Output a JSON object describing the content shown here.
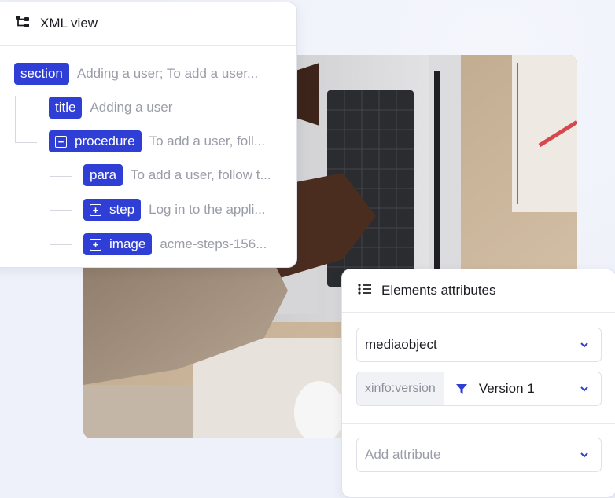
{
  "colors": {
    "accent": "#2f3fd6",
    "muted_text": "#9a9da8",
    "card_border": "#dfe2ea",
    "background": "#eef1f9"
  },
  "xml_view": {
    "title": "XML view",
    "icon": "tree-structure-icon",
    "nodes": [
      {
        "tag": "section",
        "preview": "Adding a user; To add a user..."
      },
      {
        "tag": "title",
        "preview": "Adding a user"
      },
      {
        "tag": "procedure",
        "preview": "To add a user, foll...",
        "toggle": "collapse"
      },
      {
        "tag": "para",
        "preview": "To add a user, follow t..."
      },
      {
        "tag": "step",
        "preview": "Log in to the appli...",
        "toggle": "expand"
      },
      {
        "tag": "image",
        "preview": "acme-steps-156...",
        "toggle": "expand"
      }
    ]
  },
  "attributes_panel": {
    "title": "Elements attributes",
    "icon": "list-icon",
    "element_select": {
      "value": "mediaobject"
    },
    "attribute_row": {
      "name": "xinfo:version",
      "value": "Version 1",
      "value_icon": "filter-icon"
    },
    "add_attribute": {
      "placeholder": "Add attribute"
    }
  },
  "photo": {
    "description_icon": "laptop-photo"
  }
}
